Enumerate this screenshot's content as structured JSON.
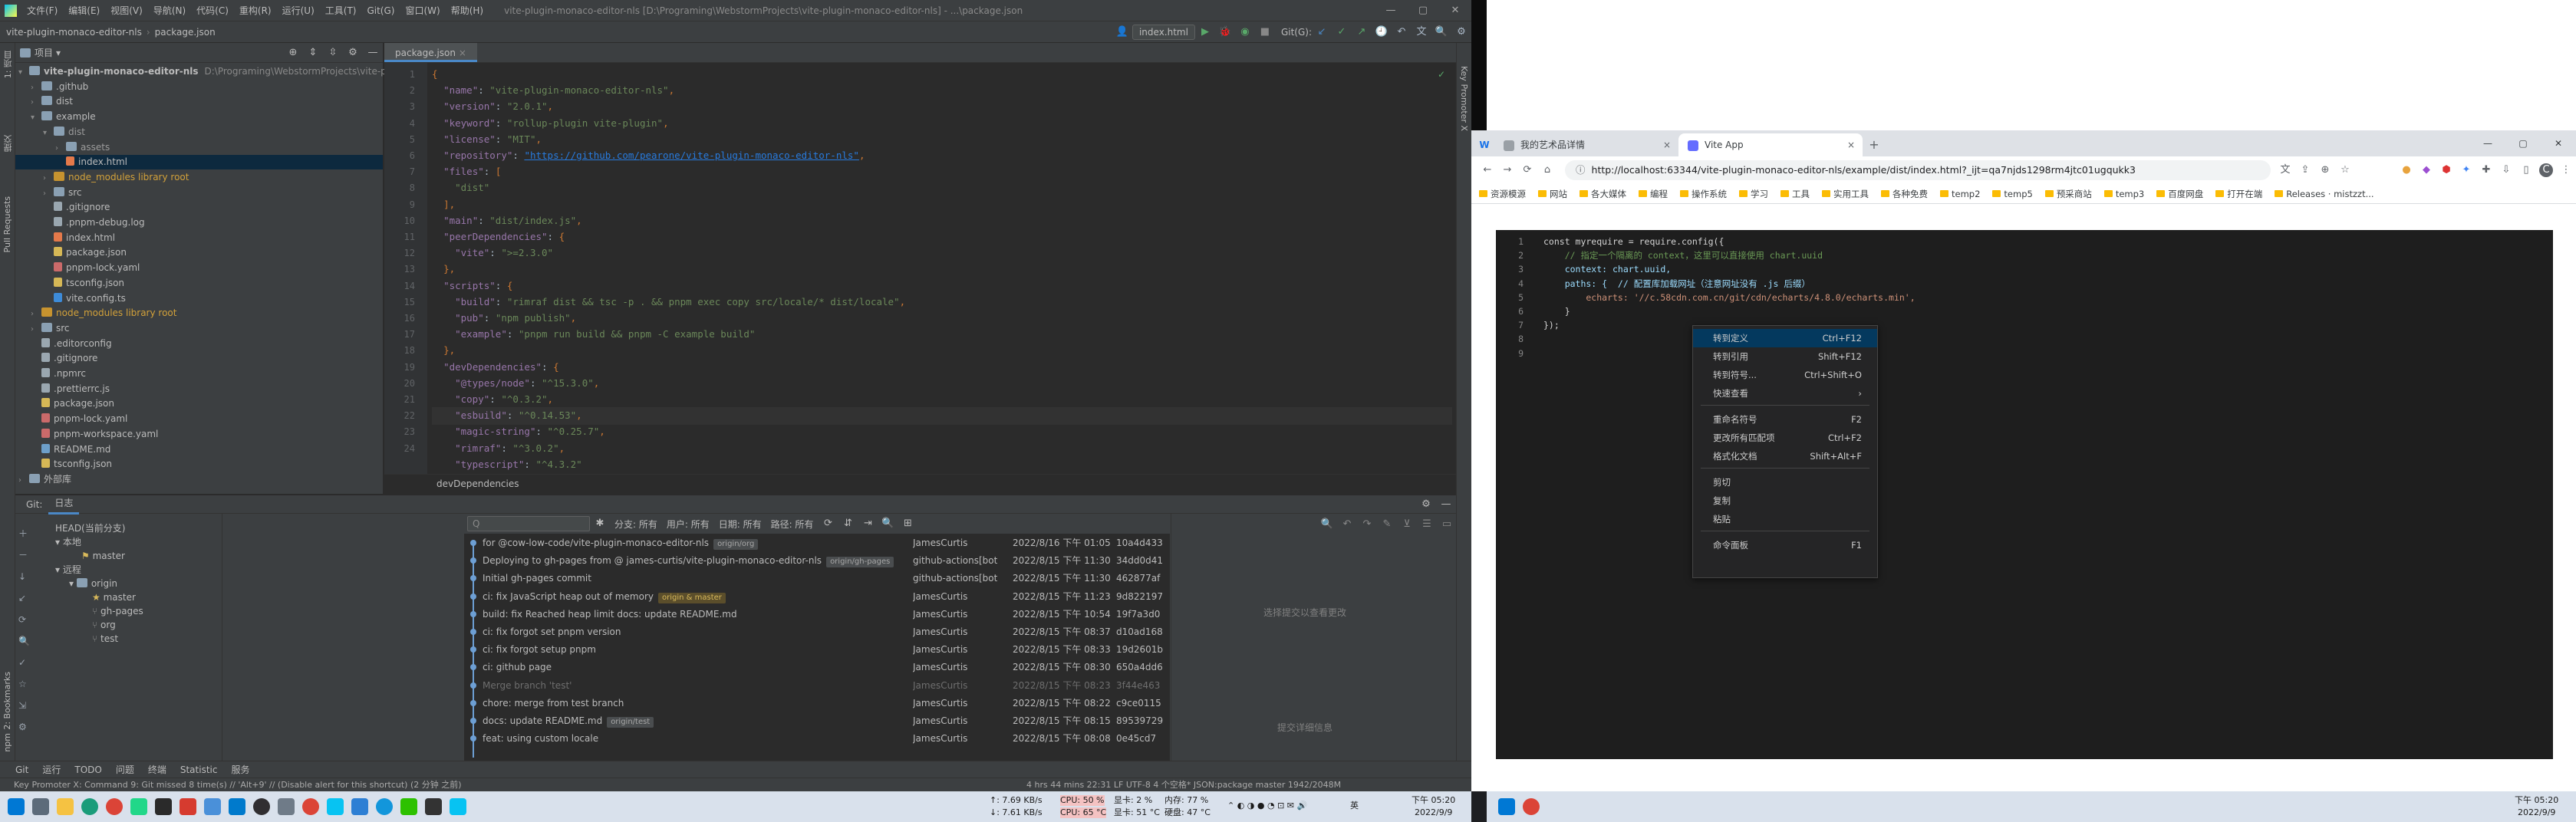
{
  "ide": {
    "menu": [
      "文件(F)",
      "编辑(E)",
      "视图(V)",
      "导航(N)",
      "代码(C)",
      "重构(R)",
      "运行(U)",
      "工具(T)",
      "Git(G)",
      "窗口(W)",
      "帮助(H)"
    ],
    "window_title": "vite-plugin-monaco-editor-nls [D:\\Programing\\WebstormProjects\\vite-plugin-monaco-editor-nls] - ...\\package.json",
    "breadcrumb_project": "vite-plugin-monaco-editor-nls",
    "breadcrumb_file": "package.json",
    "run_config": "index.html",
    "git_label": "Git(G):",
    "project_panel_title": "项目",
    "tree": [
      {
        "label": "vite-plugin-monaco-editor-nls",
        "path": "D:\\Programing\\WebstormProjects\\vite-pl",
        "type": "root"
      },
      {
        "label": ".github",
        "type": "folder"
      },
      {
        "label": "dist",
        "type": "folder"
      },
      {
        "label": "example",
        "type": "folder"
      },
      {
        "label": "dist",
        "type": "folder-dim"
      },
      {
        "label": "assets",
        "type": "folder-dim"
      },
      {
        "label": "index.html",
        "type": "html"
      },
      {
        "label": "node_modules  library root",
        "type": "excluded"
      },
      {
        "label": "src",
        "type": "folder"
      },
      {
        "label": ".gitignore",
        "type": "file"
      },
      {
        "label": ".pnpm-debug.log",
        "type": "file"
      },
      {
        "label": "index.html",
        "type": "html"
      },
      {
        "label": "package.json",
        "type": "json"
      },
      {
        "label": "pnpm-lock.yaml",
        "type": "yaml"
      },
      {
        "label": "tsconfig.json",
        "type": "json"
      },
      {
        "label": "vite.config.ts",
        "type": "ts"
      },
      {
        "label": "node_modules  library root",
        "type": "excluded"
      },
      {
        "label": "src",
        "type": "folder"
      },
      {
        "label": ".editorconfig",
        "type": "file"
      },
      {
        "label": ".gitignore",
        "type": "file"
      },
      {
        "label": ".npmrc",
        "type": "file"
      },
      {
        "label": ".prettierrc.js",
        "type": "file"
      },
      {
        "label": "package.json",
        "type": "json"
      },
      {
        "label": "pnpm-lock.yaml",
        "type": "yaml"
      },
      {
        "label": "pnpm-workspace.yaml",
        "type": "yaml"
      },
      {
        "label": "README.md",
        "type": "md"
      },
      {
        "label": "tsconfig.json",
        "type": "json"
      },
      {
        "label": "外部库",
        "type": "folder"
      }
    ],
    "editor_tab": "package.json",
    "line_numbers": [
      "1",
      "2",
      "3",
      "4",
      "5",
      "6",
      "7",
      "8",
      "9",
      "10",
      "11",
      "12",
      "13",
      "14",
      "15",
      "16",
      "17",
      "18",
      "19",
      "20",
      "21",
      "22",
      "23",
      "24"
    ],
    "code_lines": [
      "{",
      "  \"name\": \"vite-plugin-monaco-editor-nls\",",
      "  \"version\": \"2.0.1\",",
      "  \"keyword\": \"rollup-plugin vite-plugin\",",
      "  \"license\": \"MIT\",",
      "  \"repository\": \"https://github.com/pearone/vite-plugin-monaco-editor-nls\",",
      "  \"files\": [",
      "    \"dist\"",
      "  ],",
      "  \"main\": \"dist/index.js\",",
      "  \"peerDependencies\": {",
      "    \"vite\": \">=2.3.0\"",
      "  },",
      "  \"scripts\": {",
      "    \"build\": \"rimraf dist && tsc -p . && pnpm exec copy src/locale/* dist/locale\",",
      "    \"pub\": \"npm publish\",",
      "    \"example\": \"pnpm run build && pnpm -C example build\"",
      "  },",
      "  \"devDependencies\": {",
      "    \"@types/node\": \"^15.3.0\",",
      "    \"copy\": \"^0.3.2\",",
      "    \"esbuild\": \"^0.14.53\",",
      "    \"magic-string\": \"^0.25.7\",",
      "    \"rimraf\": \"^3.0.2\",",
      "    \"typescript\": \"^4.3.2\""
    ],
    "editor_breadcrumb": "devDependencies",
    "git_tabs": [
      "Git:",
      "日志"
    ],
    "branches": {
      "head": "HEAD(当前分支)",
      "local": "本地",
      "local_branches": [
        "master"
      ],
      "remote": "远程",
      "origin": "origin",
      "remote_branches": [
        "master",
        "gh-pages",
        "org",
        "test"
      ]
    },
    "log_filters": [
      "分支: 所有",
      "用户: 所有",
      "日期: 所有",
      "路径: 所有"
    ],
    "search_placeholder": "Q",
    "commits": [
      {
        "msg": "for @cow-low-code/vite-plugin-monaco-editor-nls",
        "tag": "origin/org",
        "author": "JamesCurtis",
        "date": "2022/8/16 下午 01:05",
        "hash": "10a4d433"
      },
      {
        "msg": "Deploying to gh-pages from @ james-curtis/vite-plugin-monaco-editor-nls",
        "tag": "origin/gh-pages",
        "author": "github-actions[bot]",
        "date": "2022/8/15 下午 11:30",
        "hash": "34dd0d41"
      },
      {
        "msg": "Initial gh-pages commit",
        "tag": "",
        "author": "github-actions[bot]",
        "date": "2022/8/15 下午 11:30",
        "hash": "462877af"
      },
      {
        "msg": "ci: fix JavaScript heap out of memory",
        "tag": "origin & master",
        "author": "JamesCurtis",
        "date": "2022/8/15 下午 11:23",
        "hash": "9d822197"
      },
      {
        "msg": "build: fix Reached heap limit docs: update README.md",
        "tag": "",
        "author": "JamesCurtis",
        "date": "2022/8/15 下午 10:54",
        "hash": "19f7a3d0"
      },
      {
        "msg": "ci: fix forgot set pnpm version",
        "tag": "",
        "author": "JamesCurtis",
        "date": "2022/8/15 下午 08:37",
        "hash": "d10ad168"
      },
      {
        "msg": "ci: fix forgot setup pnpm",
        "tag": "",
        "author": "JamesCurtis",
        "date": "2022/8/15 下午 08:33",
        "hash": "19d2601b"
      },
      {
        "msg": "ci: github page",
        "tag": "",
        "author": "JamesCurtis",
        "date": "2022/8/15 下午 08:30",
        "hash": "650a4dd6"
      },
      {
        "msg": "Merge branch 'test'",
        "tag": "",
        "author": "JamesCurtis",
        "date": "2022/8/15 下午 08:23",
        "hash": "3f44e463"
      },
      {
        "msg": "chore: merge from test branch",
        "tag": "",
        "author": "JamesCurtis",
        "date": "2022/8/15 下午 08:22",
        "hash": "c9ce0115"
      },
      {
        "msg": "docs: update README.md",
        "tag": "origin/test",
        "author": "JamesCurtis",
        "date": "2022/8/15 下午 08:15",
        "hash": "89539729"
      },
      {
        "msg": "feat: using custom locale",
        "tag": "",
        "author": "JamesCurtis",
        "date": "2022/8/15 下午 08:08",
        "hash": "0e45cd7"
      }
    ],
    "hint_select_commit": "选择提交以查看更改",
    "hint_details": "提交详细信息",
    "bottom_tabs": [
      "Git",
      "运行",
      "TODO",
      "问题",
      "终端",
      "Statistic",
      "服务"
    ],
    "status_left": "Key Promoter X: Command 9: Git missed 8 time(s) // 'Alt+9' // (Disable alert for this shortcut) (2 分钟 之前)",
    "status_right": "4 hrs 44 mins   22:31   LF   UTF-8   4 个空格*   JSON:package   master   1942/2048M"
  },
  "chrome": {
    "tabs": [
      {
        "label": "我的艺术品详情",
        "active": false
      },
      {
        "label": "Vite App",
        "active": true
      }
    ],
    "url": "http://localhost:63344/vite-plugin-monaco-editor-nls/example/dist/index.html?_ijt=qa7njds1298rm4jtc01ugqukk3",
    "bookmarks": [
      "资源模源",
      "网站",
      "各大媒体",
      "编程",
      "操作系统",
      "学习",
      "工具",
      "实用工具",
      "各种免费",
      "temp2",
      "temp5",
      "预采商站",
      "temp3",
      "百度网盘",
      "打开在端",
      "Releases · mistzzt..."
    ],
    "editor_line_numbers": [
      "1",
      "2",
      "3",
      "4",
      "5",
      "6",
      "7",
      "8",
      "9"
    ],
    "editor_lines": [
      "const myrequire = require.config({",
      "    // 指定一个隔离的 context，这里可以直接使用 chart.uuid",
      "    context: chart.uuid,",
      "    paths: {  // 配置库加载网址（注意网址没有 .js 后缀）",
      "        echarts: '//c.58cdn.com.cn/git/cdn/echarts/4.8.0/echarts.min',",
      "    }",
      "});",
      "",
      ""
    ],
    "context_menu": [
      {
        "label": "转到定义",
        "shortcut": "Ctrl+F12"
      },
      {
        "label": "转到引用",
        "shortcut": "Shift+F12"
      },
      {
        "label": "转到符号...",
        "shortcut": "Ctrl+Shift+O"
      },
      {
        "label": "快速查看",
        "shortcut": "›"
      },
      {
        "label": "重命名符号",
        "shortcut": "F2"
      },
      {
        "label": "更改所有匹配项",
        "shortcut": "Ctrl+F2"
      },
      {
        "label": "格式化文档",
        "shortcut": "Shift+Alt+F"
      },
      {
        "label": "剪切",
        "shortcut": ""
      },
      {
        "label": "复制",
        "shortcut": ""
      },
      {
        "label": "粘贴",
        "shortcut": ""
      },
      {
        "label": "命令面板",
        "shortcut": "F1"
      }
    ]
  },
  "taskbar": {
    "net_up": "↑: 7.69 KB/s",
    "net_down": "↓: 7.61 KB/s",
    "cpu": "CPU: 50 %",
    "cpu_temp": "CPU: 65 °C",
    "gpu": "显卡: 2 %",
    "gpu_temp": "显卡: 51 °C",
    "mem": "内存: 77 %",
    "disk_temp": "硬盘: 47 °C",
    "clock_left_time": "下午 05:20",
    "clock_left_date": "2022/9/9",
    "clock_right_time": "下午 05:20",
    "clock_right_date": "2022/9/9",
    "lang": "英"
  }
}
